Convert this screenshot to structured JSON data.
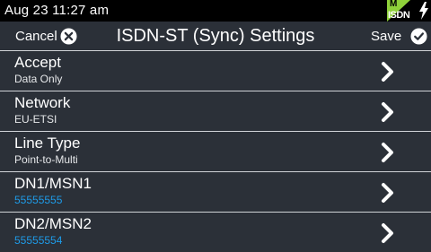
{
  "status": {
    "time": "Aug 23 11:27 am",
    "badge_top": "M",
    "badge_text": "ISDN"
  },
  "header": {
    "cancel_label": "Cancel",
    "title": "ISDN-ST (Sync) Settings",
    "save_label": "Save"
  },
  "settings": [
    {
      "label": "Accept",
      "value": "Data Only"
    },
    {
      "label": "Network",
      "value": "EU-ETSI"
    },
    {
      "label": "Line Type",
      "value": "Point-to-Multi"
    },
    {
      "label": "DN1/MSN1",
      "value": "55555555"
    },
    {
      "label": "DN2/MSN2",
      "value": "55555554"
    }
  ],
  "colors": {
    "background": "#2b3038",
    "status_bar": "#000000",
    "editable_value": "#1e9be8",
    "badge_green": "#8fd13a"
  }
}
